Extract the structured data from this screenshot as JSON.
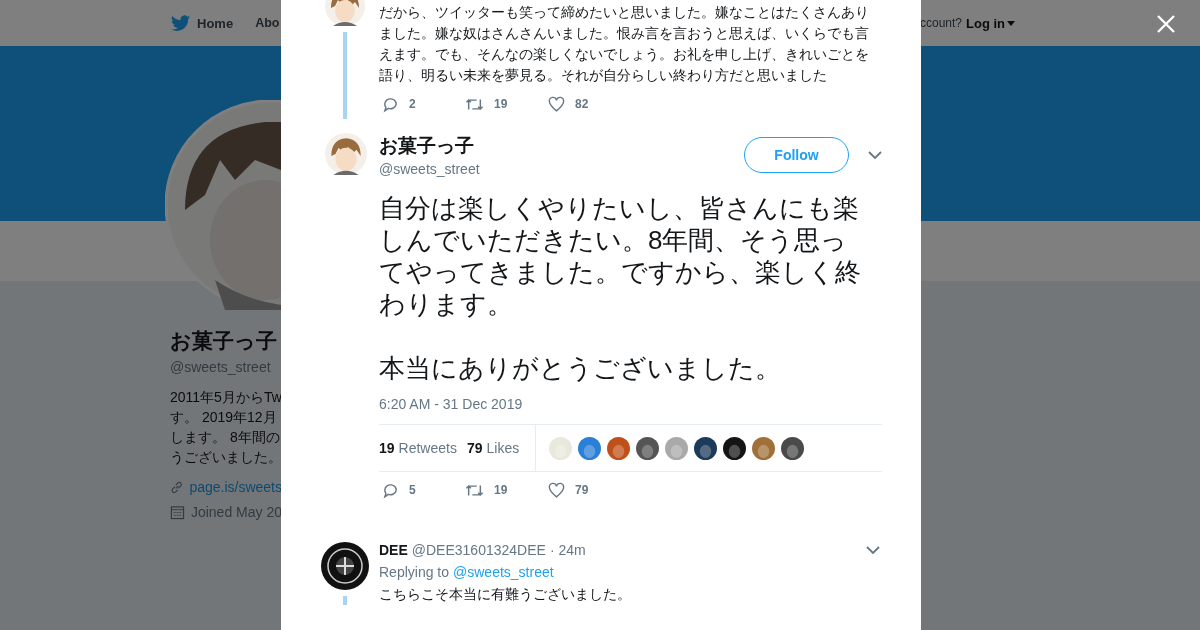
{
  "background_page": {
    "nav": {
      "home": "Home",
      "about": "Abo",
      "account_prompt": "ccount?",
      "login": "Log in"
    },
    "profile": {
      "name": "お菓子っ子",
      "handle": "@sweets_street",
      "bio": [
        "2011年5月からTw",
        "す。 2019年12月",
        "します。 8年間の",
        "うございました。"
      ],
      "link": "page.is/sweets",
      "joined": "Joined May 20"
    }
  },
  "modal": {
    "thread_tail": {
      "text": "だから、ツイッターも笑って締めたいと思いました。嫌なことはたくさんありました。嫌な奴はさんさんいました。恨み言を言おうと思えば、いくらでも言えます。でも、そんなの楽しくないでしょう。お礼を申し上げ、きれいごとを語り、明るい未来を夢見る。それが自分らしい終わり方だと思いました",
      "replies": "2",
      "retweets": "19",
      "likes": "82"
    },
    "main_tweet": {
      "name": "お菓子っ子",
      "handle": "@sweets_street",
      "follow_button": "Follow",
      "paragraphs": [
        "自分は楽しくやりたいし、皆さんにも楽しんでいただきたい。8年間、そう思ってやってきました。ですから、楽しく終わります。",
        "本当にありがとうございました。"
      ],
      "time": "6:20 AM - 31 Dec 2019",
      "retweet_count": "19",
      "retweet_label": "Retweets",
      "like_count": "79",
      "like_label": "Likes",
      "likers": [
        {
          "color": "#e8e8dc"
        },
        {
          "color": "#2a7fd6"
        },
        {
          "color": "#c0501a"
        },
        {
          "color": "#555555"
        },
        {
          "color": "#a9a9a9"
        },
        {
          "color": "#1c3a5a"
        },
        {
          "color": "#151515"
        },
        {
          "color": "#a0703a"
        },
        {
          "color": "#4a4a4a"
        }
      ],
      "replies": "5",
      "retweets": "19",
      "likes": "79"
    },
    "reply": {
      "name": "DEE",
      "handle": "@DEE31601324DEE",
      "separator": "·",
      "time": "24m",
      "replying_label": "Replying to",
      "replying_to": "@sweets_street",
      "lines": [
        "こちらこそ本当に有難うございました。"
      ]
    }
  }
}
